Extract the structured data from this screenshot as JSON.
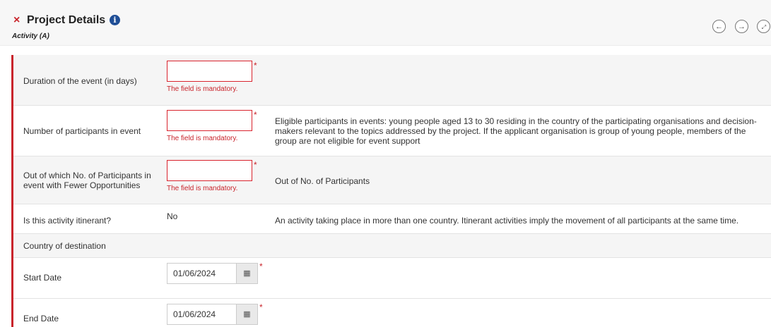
{
  "header": {
    "close_symbol": "×",
    "title": "Project Details",
    "info_symbol": "i",
    "subtitle": "Activity (A)",
    "nav_prev": "←",
    "nav_next": "→",
    "nav_fullscreen": "⤢"
  },
  "icons": {
    "close": "close-icon",
    "info": "info-icon",
    "prev": "arrow-left-icon",
    "next": "arrow-right-icon",
    "fullscreen": "expand-icon",
    "calendar": "calendar-icon"
  },
  "colors": {
    "accent_red": "#c9252c",
    "info_blue": "#1f4e96"
  },
  "form": {
    "required_mark": "*",
    "error_message": "The field is mandatory.",
    "calendar_symbol": "▦",
    "fields": {
      "duration": {
        "label": "Duration of the event (in days)",
        "value": ""
      },
      "participants": {
        "label": "Number of participants in event",
        "value": "",
        "hint": "Eligible participants in events: young people aged 13 to 30 residing in the country of the participating organisations and decision-makers relevant to the topics addressed by the project. If the applicant organisation is group of young people, members of the group are not eligible for event support"
      },
      "fewer_opportunities": {
        "label_line1": "Out of which No. of Participants in",
        "label_line2": "event with Fewer Opportunities",
        "value": "",
        "hint": "Out of No. of Participants"
      },
      "itinerant": {
        "label": "Is this activity itinerant?",
        "value": "No",
        "hint": "An activity taking place in more than one country. Itinerant activities imply the movement of all participants at the same time."
      },
      "destination": {
        "label": "Country of destination"
      },
      "start_date": {
        "label": "Start Date",
        "value": "01/06/2024"
      },
      "end_date": {
        "label": "End Date",
        "value": "01/06/2024"
      }
    }
  }
}
